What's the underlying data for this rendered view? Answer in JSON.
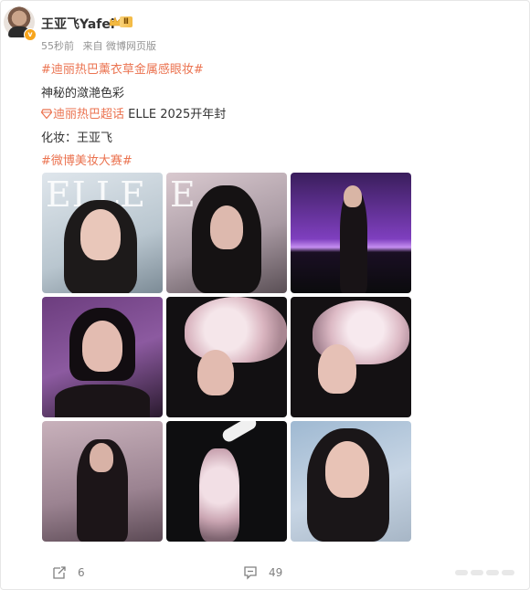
{
  "post": {
    "author": "王亚飞Yafei",
    "level_badge": "Ⅱ",
    "time": "55秒前",
    "source": "来自 微博网页版",
    "lines": {
      "hashtag1": "#迪丽热巴薰衣草金属感眼妆#",
      "text1": "神秘的潋滟色彩",
      "supertopic": "迪丽热巴超话",
      "text2": " ELLE 2025开年封",
      "text3": "化妆：王亚飞",
      "hashtag2": "#微博美妆大赛#"
    },
    "images": [
      {
        "magazine_text": "ELLE"
      },
      {
        "magazine_text": "E"
      },
      {
        "magazine_text": ""
      },
      {
        "magazine_text": ""
      },
      {
        "magazine_text": ""
      },
      {
        "magazine_text": ""
      },
      {
        "magazine_text": ""
      },
      {
        "magazine_text": ""
      },
      {
        "magazine_text": ""
      }
    ]
  },
  "actions": {
    "repost_count": "6",
    "comment_count": "49"
  },
  "colors": {
    "tag": "#eb7350",
    "meta": "#939393",
    "verify": "#f7a51c"
  }
}
